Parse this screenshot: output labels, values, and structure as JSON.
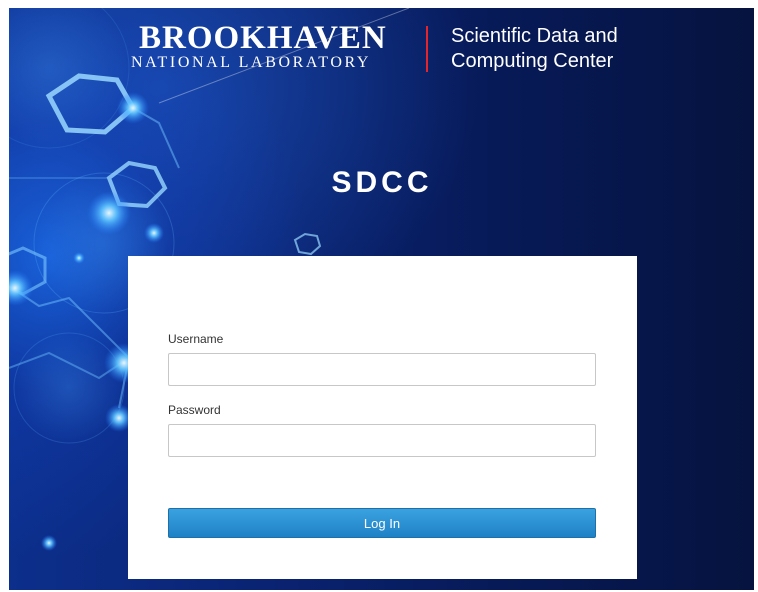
{
  "brand": {
    "lab_name": "BROOKHAVEN",
    "lab_subtitle": "NATIONAL LABORATORY",
    "center_line1": "Scientific Data and",
    "center_line2": "Computing Center",
    "accent_color": "#e4262c"
  },
  "site_title": "SDCC",
  "login_form": {
    "username_label": "Username",
    "username_value": "",
    "password_label": "Password",
    "password_value": "",
    "submit_label": "Log In",
    "button_color": "#2a8fd4"
  },
  "background": {
    "primary_color": "#0a2372",
    "glow_color": "#3fa9ff"
  }
}
